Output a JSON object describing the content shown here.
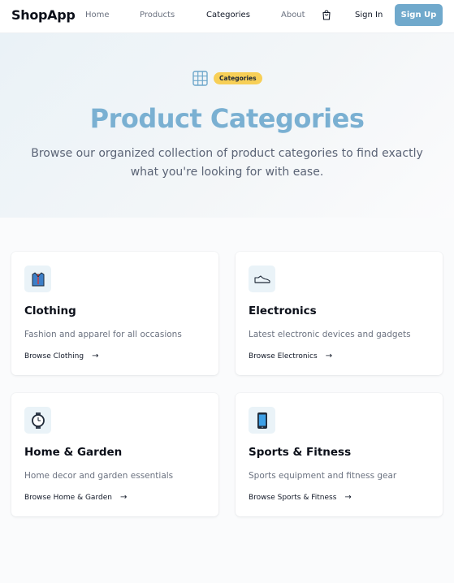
{
  "nav": {
    "brand": "ShopApp",
    "links": [
      "Home",
      "Products",
      "Categories",
      "About"
    ],
    "active": "Categories",
    "cart_icon": "shopping-bag-icon",
    "signin": "Sign In",
    "signup": "Sign Up"
  },
  "hero": {
    "icon": "grid-icon",
    "badge": "Categories",
    "title": "Product Categories",
    "subtitle": "Browse our organized collection of product categories to find exactly what you're looking for with ease."
  },
  "categories": [
    {
      "icon": "shirt-icon",
      "title": "Clothing",
      "description": "Fashion and apparel for all occasions",
      "link": "Browse Clothing"
    },
    {
      "icon": "shoe-icon",
      "title": "Electronics",
      "description": "Latest electronic devices and gadgets",
      "link": "Browse Electronics"
    },
    {
      "icon": "watch-icon",
      "title": "Home & Garden",
      "description": "Home decor and garden essentials",
      "link": "Browse Home & Garden"
    },
    {
      "icon": "phone-icon",
      "title": "Sports & Fitness",
      "description": "Sports equipment and fitness gear",
      "link": "Browse Sports & Fitness"
    }
  ],
  "colors": {
    "accent": "#70a9cc",
    "title": "#7ab0d2",
    "badge": "#f7cf57"
  }
}
